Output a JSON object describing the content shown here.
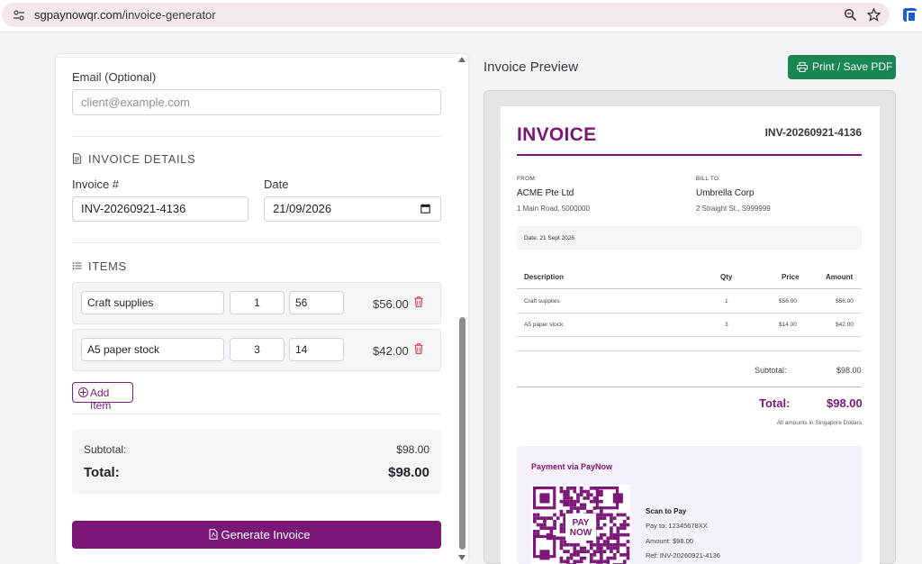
{
  "browser": {
    "url_host": "sgpaynowqr.com",
    "url_path": "/invoice-generator"
  },
  "form": {
    "email": {
      "label": "Email (Optional)",
      "placeholder": "client@example.com",
      "value": ""
    },
    "invoice_details": {
      "section_title": "INVOICE DETAILS",
      "invoice_no_label": "Invoice #",
      "invoice_no_value": "INV-20260921-4136",
      "date_label": "Date",
      "date_value": "21/09/2026"
    },
    "items_section": {
      "section_title": "ITEMS",
      "items": [
        {
          "description": "Craft supplies",
          "qty": "1",
          "price": "56",
          "amount": "$56.00"
        },
        {
          "description": "A5 paper stock",
          "qty": "3",
          "price": "14",
          "amount": "$42.00"
        }
      ],
      "add_item_label": "Add Item"
    },
    "totals": {
      "subtotal_label": "Subtotal:",
      "subtotal_value": "$98.00",
      "total_label": "Total:",
      "total_value": "$98.00"
    },
    "generate_label": "Generate Invoice"
  },
  "preview": {
    "heading": "Invoice Preview",
    "print_label": "Print / Save PDF",
    "invoice": {
      "title": "INVOICE",
      "number": "INV-20260921-4136",
      "from_label": "FROM:",
      "from_name": "ACME Pte Ltd",
      "from_address": "1 Main Road, 5000000",
      "bill_to_label": "BILL TO:",
      "bill_to_name": "Umbrella Corp",
      "bill_to_address": "2 Straight St., S999999",
      "date_line": "Date: 21 Sept 2026",
      "table_headers": {
        "description": "Description",
        "qty": "Qty",
        "price": "Price",
        "amount": "Amount"
      },
      "rows": [
        {
          "description": "Craft supplies",
          "qty": "1",
          "price": "$56.00",
          "amount": "$56.00"
        },
        {
          "description": "A5 paper stock",
          "qty": "3",
          "price": "$14.00",
          "amount": "$42.00"
        }
      ],
      "subtotal_label": "Subtotal:",
      "subtotal_value": "$98.00",
      "total_label": "Total:",
      "total_value": "$98.00",
      "currency_note": "All amounts in Singapore Dollars"
    },
    "payment": {
      "title": "Payment via PayNow",
      "qr_logo_text": "PAY NOW",
      "scan_title": "Scan to Pay",
      "pay_to": "Pay to: 12345678XX",
      "amount": "Amount: $98.00",
      "ref": "Ref: INV-20260921-4136"
    }
  },
  "colors": {
    "brand_purple": "#7b1877",
    "print_green": "#198754",
    "delete_red": "#dc3545"
  }
}
